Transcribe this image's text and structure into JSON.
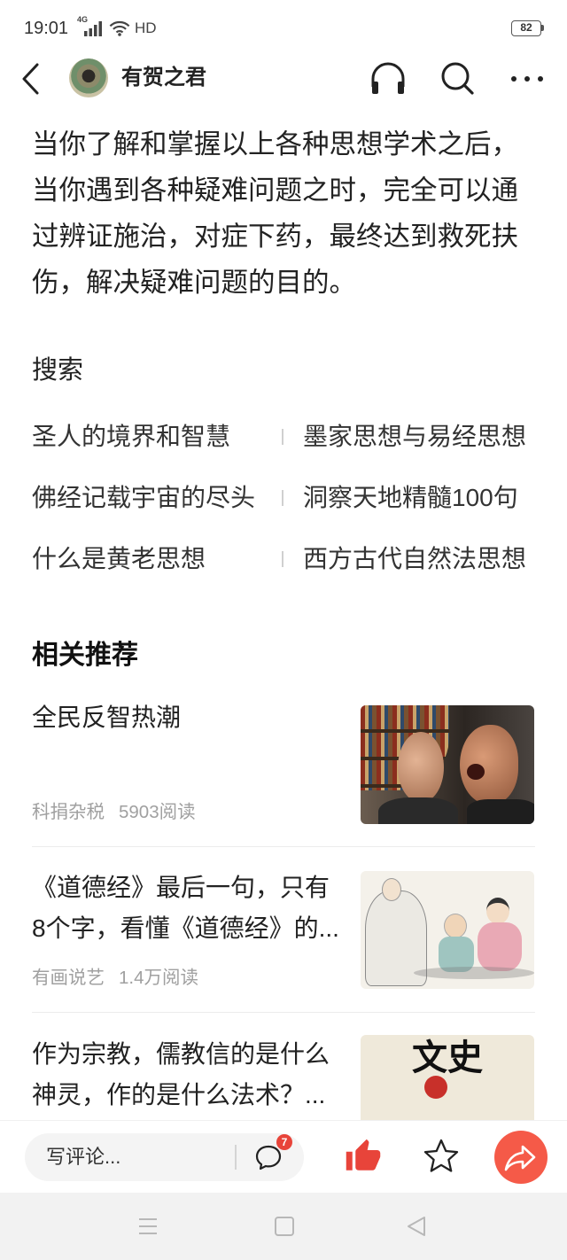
{
  "status_bar": {
    "time": "19:01",
    "network": "4G",
    "hd": "HD",
    "battery": "82"
  },
  "header": {
    "author_name": "有贺之君"
  },
  "article": {
    "paragraph": "当你了解和掌握以上各种思想学术之后，当你遇到各种疑难问题之时，完全可以通过辨证施治，对症下药，最终达到救死扶伤，解决疑难问题的目的。"
  },
  "search": {
    "heading": "搜索",
    "rows": [
      {
        "left": "圣人的境界和智慧",
        "right": "墨家思想与易经思想"
      },
      {
        "left": "佛经记载宇宙的尽头",
        "right": "洞察天地精髓100句"
      },
      {
        "left": "什么是黄老思想",
        "right": "西方古代自然法思想"
      }
    ]
  },
  "recommend": {
    "heading": "相关推荐",
    "items": [
      {
        "title_lines": [
          "全民反智热潮"
        ],
        "source": "科捐杂税",
        "reads": "5903阅读"
      },
      {
        "title_lines": [
          "《道德经》最后一句，只有",
          "8个字，看懂《道德经》的..."
        ],
        "source": "有画说艺",
        "reads": "1.4万阅读"
      },
      {
        "title_lines": [
          "作为宗教，儒教信的是什么",
          "神灵，作的是什么法术？..."
        ],
        "thumbnail_logo_text": "文史"
      }
    ]
  },
  "bottom_bar": {
    "comment_placeholder": "写评论...",
    "comment_badge_count": "7"
  },
  "colors": {
    "text_primary": "#222222",
    "text_secondary": "#a0a0a0",
    "accent_red": "#f55a48",
    "like_red": "#e8443a",
    "nav_bar_bg": "#f2f2f2"
  },
  "icons": {
    "back": "back-arrow-icon",
    "headphone": "headphone-icon",
    "search": "search-icon",
    "more": "more-dots-icon",
    "comment": "comment-bubble-icon",
    "like": "thumbs-up-icon",
    "favorite": "star-icon",
    "share": "share-arrow-icon",
    "nav_menu": "menu-icon",
    "nav_home": "home-square-icon",
    "nav_back": "back-triangle-icon",
    "signal": "signal-icon",
    "wifi": "wifi-icon",
    "battery": "battery-icon"
  }
}
